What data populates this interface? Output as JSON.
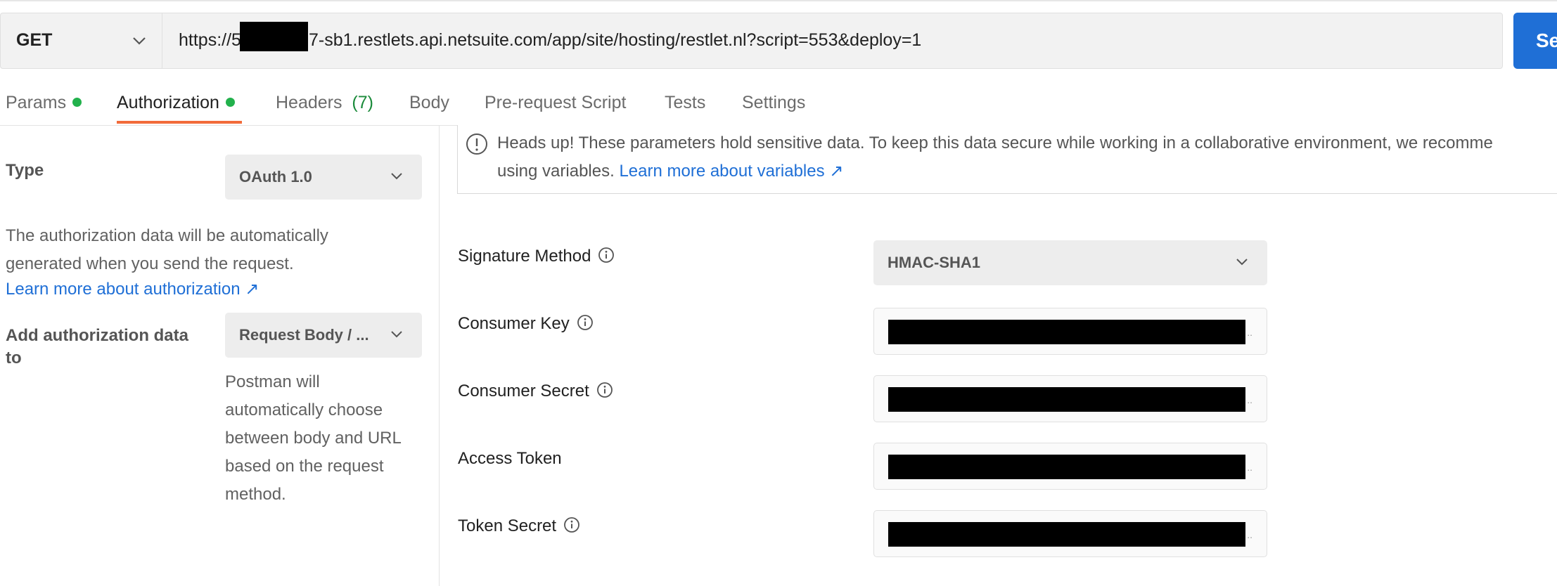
{
  "request": {
    "method": "GET",
    "url_prefix": "https://5",
    "url_suffix": "7-sb1.restlets.api.netsuite.com/app/site/hosting/restlet.nl?script=553&deploy=1",
    "send_label": "Se"
  },
  "tabs": [
    {
      "label": "Params",
      "dot": true
    },
    {
      "label": "Authorization",
      "dot": true
    },
    {
      "label": "Headers",
      "count": "(7)"
    },
    {
      "label": "Body"
    },
    {
      "label": "Pre-request Script"
    },
    {
      "label": "Tests"
    },
    {
      "label": "Settings"
    }
  ],
  "auth_left": {
    "type_label": "Type",
    "type_value": "OAuth 1.0",
    "desc_line1": "The authorization data will be automatically",
    "desc_line2": "generated when you send the request.",
    "learn_link": "Learn more about authorization ↗",
    "add_to_label_1": "Add authorization data",
    "add_to_label_2": "to",
    "add_to_value": "Request Body / ...",
    "help_lines": [
      "Postman will",
      "automatically choose",
      "between body and URL",
      "based on the request",
      "method."
    ]
  },
  "notice": {
    "line1": "Heads up! These parameters hold sensitive data. To keep this data secure while working in a collaborative environment, we recomme",
    "line2_prefix": "using variables. ",
    "link": "Learn more about variables ↗"
  },
  "fields": {
    "signature_method": {
      "label": "Signature Method",
      "value": "HMAC-SHA1"
    },
    "consumer_key": {
      "label": "Consumer Key"
    },
    "consumer_secret": {
      "label": "Consumer Secret"
    },
    "access_token": {
      "label": "Access Token"
    },
    "token_secret": {
      "label": "Token Secret"
    }
  },
  "colors": {
    "accent": "#f26b3a",
    "primary": "#1f6fd6",
    "dot": "#22b14c"
  }
}
